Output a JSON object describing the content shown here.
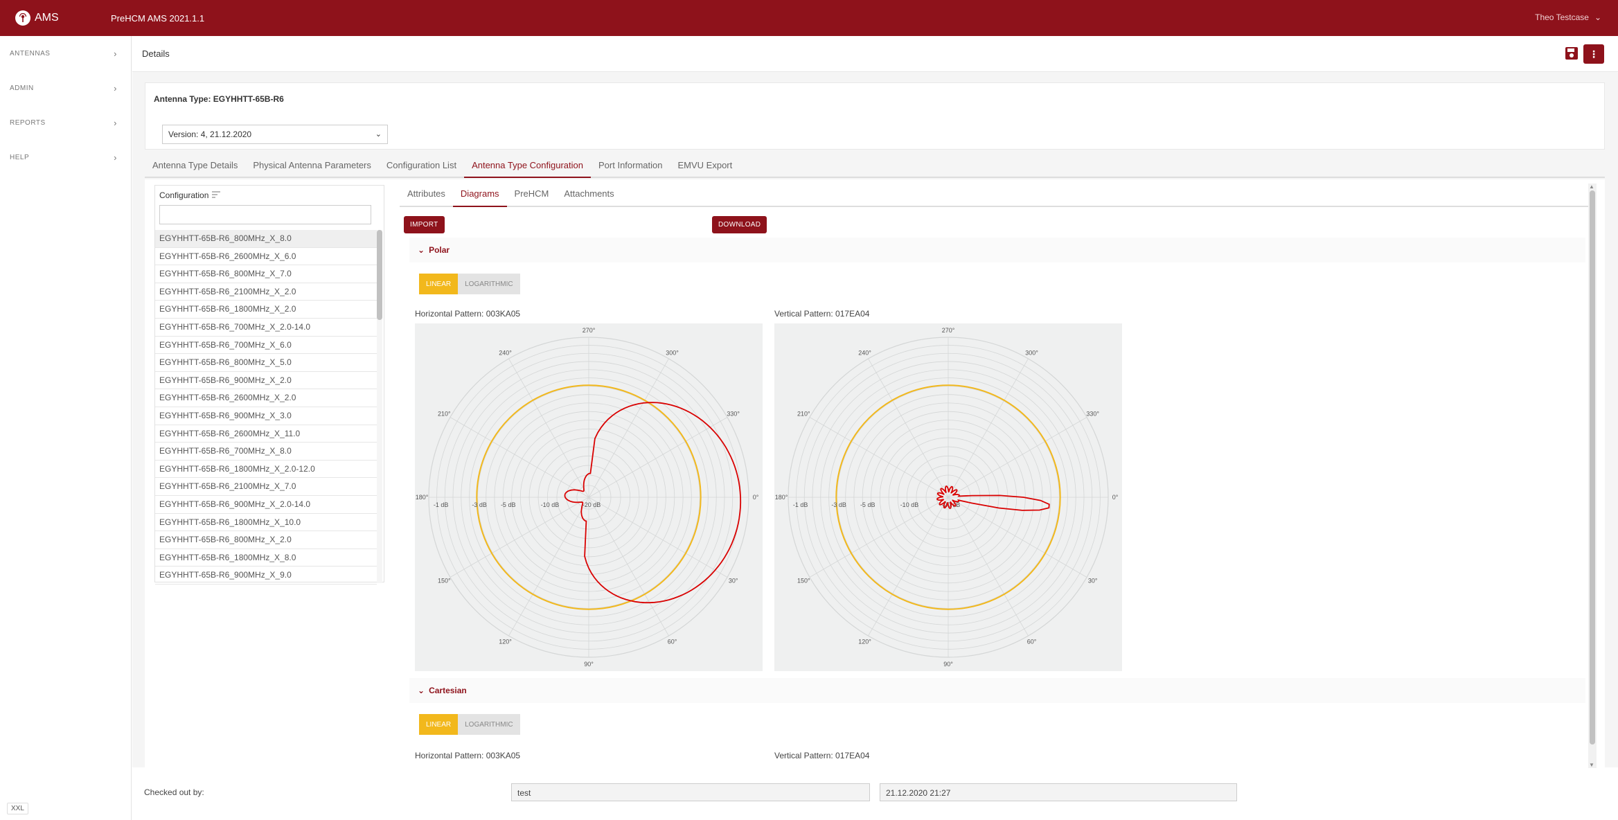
{
  "app": {
    "logo_text": "AMS",
    "title": "PreHCM AMS 2021.1.1",
    "user": "Theo Testcase"
  },
  "sidebar": {
    "items": [
      {
        "label": "ANTENNAS"
      },
      {
        "label": "ADMIN"
      },
      {
        "label": "REPORTS"
      },
      {
        "label": "HELP"
      }
    ],
    "size_badge": "XXL"
  },
  "header": {
    "title": "Details"
  },
  "antenna": {
    "type_label": "Antenna Type: EGYHHTT-65B-R6",
    "version": "Version: 4, 21.12.2020"
  },
  "tabs": [
    {
      "label": "Antenna Type Details"
    },
    {
      "label": "Physical Antenna Parameters"
    },
    {
      "label": "Configuration List"
    },
    {
      "label": "Antenna Type Configuration"
    },
    {
      "label": "Port Information"
    },
    {
      "label": "EMVU Export"
    }
  ],
  "configuration": {
    "heading": "Configuration",
    "items": [
      "EGYHHTT-65B-R6_800MHz_X_8.0",
      "EGYHHTT-65B-R6_2600MHz_X_6.0",
      "EGYHHTT-65B-R6_800MHz_X_7.0",
      "EGYHHTT-65B-R6_2100MHz_X_2.0",
      "EGYHHTT-65B-R6_1800MHz_X_2.0",
      "EGYHHTT-65B-R6_700MHz_X_2.0-14.0",
      "EGYHHTT-65B-R6_700MHz_X_6.0",
      "EGYHHTT-65B-R6_800MHz_X_5.0",
      "EGYHHTT-65B-R6_900MHz_X_2.0",
      "EGYHHTT-65B-R6_2600MHz_X_2.0",
      "EGYHHTT-65B-R6_900MHz_X_3.0",
      "EGYHHTT-65B-R6_2600MHz_X_11.0",
      "EGYHHTT-65B-R6_700MHz_X_8.0",
      "EGYHHTT-65B-R6_1800MHz_X_2.0-12.0",
      "EGYHHTT-65B-R6_2100MHz_X_7.0",
      "EGYHHTT-65B-R6_900MHz_X_2.0-14.0",
      "EGYHHTT-65B-R6_1800MHz_X_10.0",
      "EGYHHTT-65B-R6_800MHz_X_2.0",
      "EGYHHTT-65B-R6_1800MHz_X_8.0",
      "EGYHHTT-65B-R6_900MHz_X_9.0"
    ]
  },
  "subtabs": [
    {
      "label": "Attributes"
    },
    {
      "label": "Diagrams"
    },
    {
      "label": "PreHCM"
    },
    {
      "label": "Attachments"
    }
  ],
  "buttons": {
    "import": "IMPORT",
    "download": "DOWNLOAD"
  },
  "polar": {
    "title": "Polar",
    "toggle": {
      "linear": "LINEAR",
      "log": "LOGARITHMIC"
    },
    "horizontal_label": "Horizontal Pattern: 003KA05",
    "vertical_label": "Vertical Pattern: 017EA04",
    "angle_labels": [
      "0°",
      "30°",
      "60°",
      "90°",
      "120°",
      "150°",
      "180°",
      "210°",
      "240°",
      "270°",
      "300°",
      "330°"
    ],
    "db_labels": [
      "-1 dB",
      "-3 dB",
      "-5 dB",
      "-10 dB",
      "-20 dB"
    ]
  },
  "cartesian": {
    "title": "Cartesian",
    "toggle": {
      "linear": "LINEAR",
      "log": "LOGARITHMIC"
    },
    "horizontal_label": "Horizontal Pattern: 003KA05",
    "vertical_label": "Vertical Pattern: 017EA04"
  },
  "footer": {
    "checked_out_label": "Checked out by:",
    "checked_out_user": "test",
    "checked_out_date": "21.12.2020 21:27"
  },
  "colors": {
    "brand": "#8e121b",
    "accent": "#f2b81c",
    "pattern": "#d90000"
  }
}
